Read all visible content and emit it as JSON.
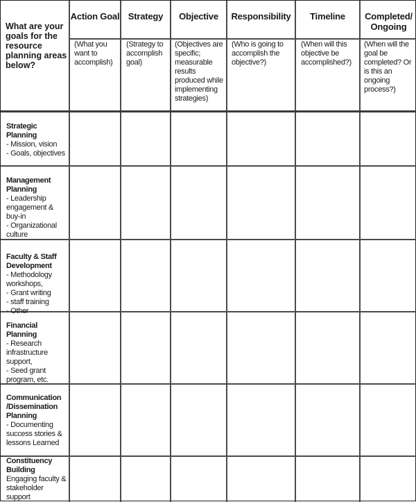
{
  "question": "What are your goals for the resource planning areas below?",
  "columns": [
    {
      "title": "Action Goal",
      "description": "(What you want to accomplish)"
    },
    {
      "title": "Strategy",
      "description": "(Strategy to accomplish goal)"
    },
    {
      "title": "Objective",
      "description": "(Objectives are specific; measurable results produced while implementing strategies)"
    },
    {
      "title": "Responsibility",
      "description": "(Who is going to accomplish the objective?)"
    },
    {
      "title": "Timeline",
      "description": "(When will this objective be accomplished?)"
    },
    {
      "title": "Completed/ Ongoing",
      "description": "(When will the goal be completed? Or is this an ongoing process?)"
    }
  ],
  "rows": [
    {
      "heading": "Strategic Planning",
      "items": [
        "- Mission, vision",
        "- Goals, objectives"
      ]
    },
    {
      "heading": "Management Planning",
      "items": [
        "- Leadership engagement & buy-in",
        "- Organizational culture"
      ]
    },
    {
      "heading": "Faculty & Staff Development",
      "items": [
        "- Methodology workshops,",
        "- Grant writing",
        "- staff training",
        "- Other"
      ]
    },
    {
      "heading": "Financial Planning",
      "items": [
        "- Research infrastructure support,",
        "- Seed grant program, etc."
      ]
    },
    {
      "heading": "Communication /Dissemination Planning",
      "items": [
        "- Documenting success stories & lessons Learned"
      ]
    },
    {
      "heading": "Constituency Building",
      "items": [
        "Engaging faculty & stakeholder support"
      ]
    }
  ]
}
